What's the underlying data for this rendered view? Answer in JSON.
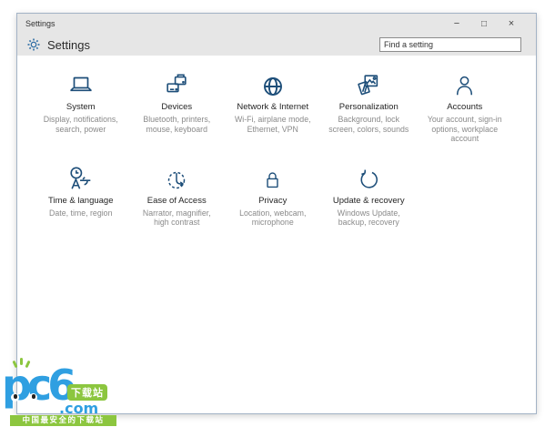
{
  "window": {
    "title": "Settings",
    "controls": {
      "minimize": "−",
      "maximize": "□",
      "close": "×"
    }
  },
  "header": {
    "title": "Settings",
    "search_value": "Find a setting"
  },
  "categories": [
    {
      "label": "System",
      "description": "Display, notifications,\nsearch, power",
      "icon": "laptop-icon"
    },
    {
      "label": "Devices",
      "description": "Bluetooth, printers,\nmouse, keyboard",
      "icon": "printer-devices-icon"
    },
    {
      "label": "Network & Internet",
      "description": "Wi-Fi, airplane mode,\nEthernet, VPN",
      "icon": "globe-icon"
    },
    {
      "label": "Personalization",
      "description": "Background, lock\nscreen, colors, sounds",
      "icon": "picture-frames-icon"
    },
    {
      "label": "Accounts",
      "description": "Your account, sign-in\noptions, workplace\naccount",
      "icon": "person-icon"
    },
    {
      "label": "Time & language",
      "description": "Date, time, region",
      "icon": "clock-language-icon"
    },
    {
      "label": "Ease of Access",
      "description": "Narrator, magnifier,\nhigh contrast",
      "icon": "dashed-circle-arrow-icon"
    },
    {
      "label": "Privacy",
      "description": "Location, webcam,\nmicrophone",
      "icon": "lock-icon"
    },
    {
      "label": "Update & recovery",
      "description": "Windows Update,\nbackup, recovery",
      "icon": "refresh-arrow-icon"
    }
  ],
  "watermark": {
    "brand": "pc6",
    "suffix": ".com",
    "badge": "下载站",
    "tagline": "中国最安全的下载站"
  },
  "colors": {
    "chrome_gray": "#e6e6e6",
    "icon_navy": "#1d4e79",
    "gear_blue": "#2e6da4",
    "watermark_blue": "#2f9fe1",
    "watermark_green": "#8cc63f"
  }
}
